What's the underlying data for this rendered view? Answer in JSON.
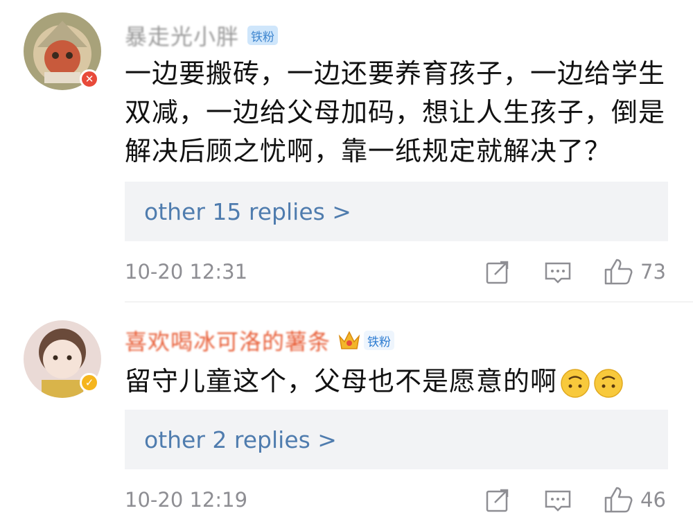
{
  "comments": [
    {
      "username": "暴走光小胖",
      "fan_badge": "铁粉",
      "text_lines": [
        "一边要搬砖，一边还要养育孩子，一边给学生",
        "双减，一边给父母加码，想让人生孩子，倒是",
        "解决后顾之忧啊，靠一纸规定就解决了？"
      ],
      "replies_label": "other 15 replies >",
      "time": "10-20 12:31",
      "likes": "73",
      "verified_badge_color": "#e84a3a"
    },
    {
      "username": "喜欢喝冰可洛的薯条",
      "username_color": "#e8603a",
      "fan_badge": "铁粉",
      "text": "留守儿童这个，父母也不是愿意的啊",
      "emoji": [
        "upside-down-face-icon",
        "upside-down-face-icon"
      ],
      "replies_label": "other 2 replies >",
      "time": "10-20 12:19",
      "likes": "46",
      "verified_badge_color": "#f5b51e"
    }
  ],
  "colors": {
    "link": "#4f7cae",
    "meta": "#8e8e93",
    "reply_bg": "#f2f3f5"
  }
}
